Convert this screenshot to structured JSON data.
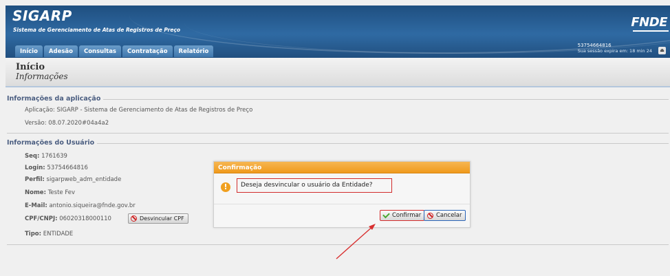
{
  "header": {
    "logo": "SIGARP",
    "logo_subtitle": "Sistema de Gerenciamento de Atas de Registros de Preço",
    "brand_right": "FNDE",
    "user_login": "53754664816",
    "session_text": "Sua sessão expira em: 18 min 24",
    "nav": [
      "Início",
      "Adesão",
      "Consultas",
      "Contratação",
      "Relatório"
    ]
  },
  "title": {
    "main": "Início",
    "sub": "Informações"
  },
  "app_info": {
    "legend": "Informações da aplicação",
    "application": "Aplicação: SIGARP - Sistema de Gerenciamento de Atas de Registros de Preço",
    "version": "Versão: 08.07.2020#04a4a2"
  },
  "user_info": {
    "legend": "Informações do Usuário",
    "seq_label": "Seq:",
    "seq_value": "1761639",
    "login_label": "Login:",
    "login_value": "53754664816",
    "perfil_label": "Perfil:",
    "perfil_value": "sigarpweb_adm_entidade",
    "nome_label": "Nome:",
    "nome_value": "Teste Fev",
    "email_label": "E-Mail:",
    "email_value": "antonio.siqueira@fnde.gov.br",
    "cpf_label": "CPF/CNPJ:",
    "cpf_value": "06020318000110",
    "desvincular_button": "Desvincular CPF",
    "tipo_label": "Tipo:",
    "tipo_value": "ENTIDADE"
  },
  "dialog": {
    "title": "Confirmação",
    "message": "Deseja desvincular o usuário da Entidade?",
    "confirm_label": "Confirmar",
    "cancel_label": "Cancelar"
  },
  "colors": {
    "header_blue": "#2f6aa3",
    "dialog_orange": "#f09a1c",
    "highlight_red": "#d22b2b"
  }
}
